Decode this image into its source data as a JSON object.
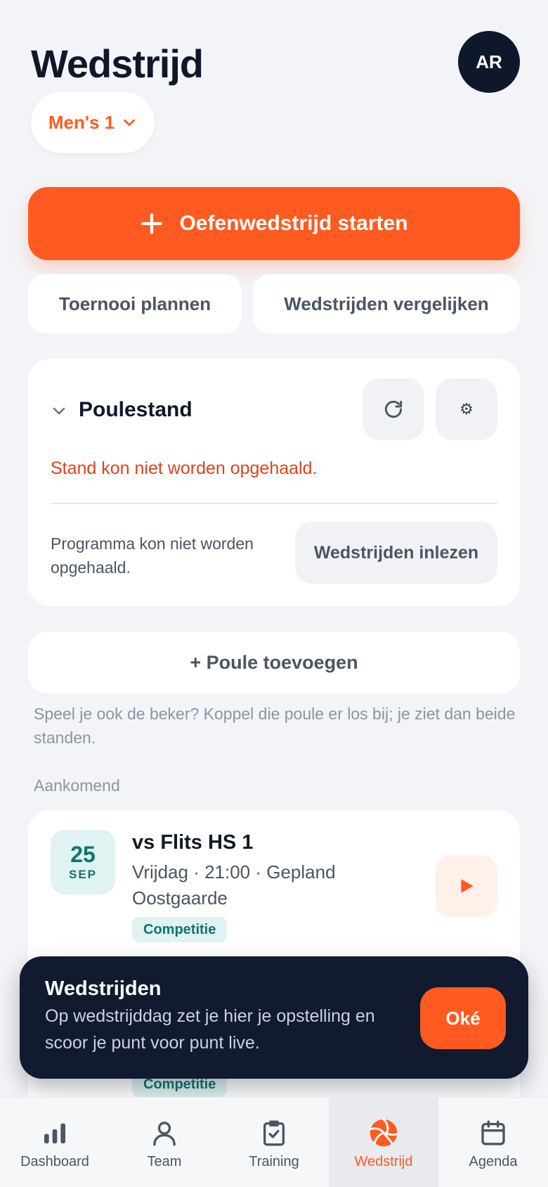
{
  "header": {
    "title": "Wedstrijd",
    "avatar_initials": "AR",
    "team_selector": "Men's 1"
  },
  "actions": {
    "primary": "Oefenwedstrijd starten",
    "plan_tournament": "Toernooi plannen",
    "compare_matches": "Wedstrijden vergelijken"
  },
  "poule": {
    "title": "Poulestand",
    "error": "Stand kon niet worden opgehaald.",
    "program_error": "Programma kon niet worden opgehaald.",
    "import_button": "Wedstrijden inlezen"
  },
  "add_poule": {
    "label": "+ Poule toevoegen",
    "hint": "Speel je ook de beker? Koppel die poule er los bij; je ziet dan beide standen."
  },
  "upcoming": {
    "label": "Aankomend",
    "match": {
      "day": "25",
      "month": "SEP",
      "opponent": "vs Flits HS 1",
      "details": "Vrijdag · 21:00 · Gepland Oostgaarde",
      "tag": "Competitie"
    },
    "next_tag": "Competitie"
  },
  "toast": {
    "title": "Wedstrijden",
    "body": "Op wedstrijddag zet je hier je opstelling en scoor je punt voor punt live.",
    "ok": "Oké"
  },
  "nav": {
    "dashboard": "Dashboard",
    "team": "Team",
    "training": "Training",
    "wedstrijd": "Wedstrijd",
    "agenda": "Agenda"
  },
  "colors": {
    "accent": "#ff5a1f",
    "dark": "#0f172a",
    "teal": "#0f766e",
    "error": "#e0431a"
  },
  "icons": {
    "refresh": "refresh-icon",
    "settings": "gear-icon",
    "play": "play-icon",
    "collapse": "chevron-down-icon"
  }
}
